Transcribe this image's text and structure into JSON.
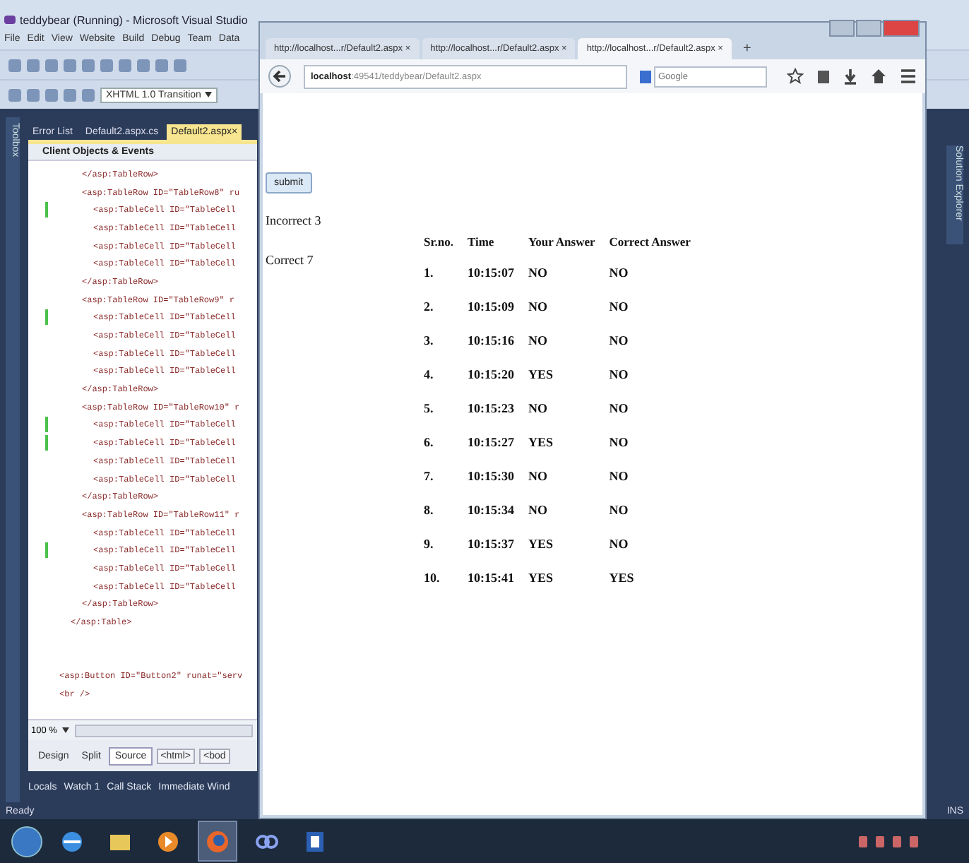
{
  "vs": {
    "title": "teddybear (Running) - Microsoft Visual Studio",
    "menu": [
      "File",
      "Edit",
      "View",
      "Website",
      "Build",
      "Debug",
      "Team",
      "Data"
    ],
    "toolbar_dropdown": "XHTML 1.0 Transition",
    "toolbox_label": "Toolbox",
    "doc_tabs": [
      {
        "label": "Error List",
        "selected": false
      },
      {
        "label": "Default2.aspx.cs",
        "selected": false
      },
      {
        "label": "Default2.aspx",
        "selected": true,
        "close": "×"
      }
    ],
    "member_dropdown": "Client Objects & Events",
    "code_lines": [
      {
        "text": "</asp:TableRow>",
        "kind": "row",
        "changed": false
      },
      {
        "text": "<asp:TableRow ID=\"TableRow8\" ru",
        "kind": "row",
        "changed": false
      },
      {
        "text": "<asp:TableCell ID=\"TableCell",
        "kind": "cell",
        "changed": true
      },
      {
        "text": "<asp:TableCell ID=\"TableCell",
        "kind": "cell",
        "changed": false
      },
      {
        "text": "<asp:TableCell ID=\"TableCell",
        "kind": "cell",
        "changed": false
      },
      {
        "text": "<asp:TableCell ID=\"TableCell",
        "kind": "cell",
        "changed": false
      },
      {
        "text": "</asp:TableRow>",
        "kind": "row",
        "changed": false
      },
      {
        "text": "<asp:TableRow ID=\"TableRow9\" r",
        "kind": "row",
        "changed": false
      },
      {
        "text": "<asp:TableCell ID=\"TableCell",
        "kind": "cell",
        "changed": true
      },
      {
        "text": "<asp:TableCell ID=\"TableCell",
        "kind": "cell",
        "changed": false
      },
      {
        "text": "<asp:TableCell ID=\"TableCell",
        "kind": "cell",
        "changed": false
      },
      {
        "text": "<asp:TableCell ID=\"TableCell",
        "kind": "cell",
        "changed": false
      },
      {
        "text": "</asp:TableRow>",
        "kind": "row",
        "changed": false
      },
      {
        "text": "<asp:TableRow ID=\"TableRow10\" r",
        "kind": "row",
        "changed": false
      },
      {
        "text": "<asp:TableCell ID=\"TableCell",
        "kind": "cell",
        "changed": true
      },
      {
        "text": "<asp:TableCell ID=\"TableCell",
        "kind": "cell",
        "changed": true
      },
      {
        "text": "<asp:TableCell ID=\"TableCell",
        "kind": "cell",
        "changed": false
      },
      {
        "text": "<asp:TableCell ID=\"TableCell",
        "kind": "cell",
        "changed": false
      },
      {
        "text": "</asp:TableRow>",
        "kind": "row",
        "changed": false
      },
      {
        "text": "<asp:TableRow ID=\"TableRow11\" r",
        "kind": "row",
        "changed": false
      },
      {
        "text": "<asp:TableCell ID=\"TableCell",
        "kind": "cell",
        "changed": false
      },
      {
        "text": "<asp:TableCell ID=\"TableCell",
        "kind": "cell",
        "changed": true
      },
      {
        "text": "<asp:TableCell ID=\"TableCell",
        "kind": "cell",
        "changed": false
      },
      {
        "text": "<asp:TableCell ID=\"TableCell",
        "kind": "cell",
        "changed": false
      },
      {
        "text": "</asp:TableRow>",
        "kind": "row",
        "changed": false
      },
      {
        "text": "</asp:Table>",
        "kind": "table",
        "changed": false
      }
    ],
    "code_lines_after": [
      {
        "text": "<asp:Button ID=\"Button2\" runat=\"serv",
        "kind": "form",
        "changed": false
      },
      {
        "text": "<br />",
        "kind": "form",
        "changed": false
      }
    ],
    "zoom": "100 %",
    "view_tabs": [
      {
        "label": "Design",
        "selected": false
      },
      {
        "label": "Split",
        "selected": false
      },
      {
        "label": "Source",
        "selected": true
      }
    ],
    "breadcrumbs": [
      "<html>",
      "<bod"
    ],
    "tool_tabs": [
      "Locals",
      "Watch 1",
      "Call Stack",
      "Immediate Wind"
    ],
    "status": "Ready",
    "ins": "INS",
    "solution_explorer_label": "Solution Explorer"
  },
  "browser": {
    "tabs": [
      {
        "label": "http://localhost...r/Default2.aspx",
        "selected": false,
        "close": "×"
      },
      {
        "label": "http://localhost...r/Default2.aspx",
        "selected": false,
        "close": "×"
      },
      {
        "label": "http://localhost...r/Default2.aspx",
        "selected": true,
        "close": "×"
      }
    ],
    "new_tab": "+",
    "url_host": "localhost",
    "url_path": ":49541/teddybear/Default2.aspx",
    "search_placeholder": "Google",
    "submit": "submit",
    "incorrect": "Incorrect 3",
    "correct": "Correct 7",
    "table": {
      "columns": [
        "Sr.no.",
        "Time",
        "Your Answer",
        "Correct Answer"
      ],
      "rows": [
        [
          "1.",
          "10:15:07",
          "NO",
          "NO"
        ],
        [
          "2.",
          "10:15:09",
          "NO",
          "NO"
        ],
        [
          "3.",
          "10:15:16",
          "NO",
          "NO"
        ],
        [
          "4.",
          "10:15:20",
          "YES",
          "NO"
        ],
        [
          "5.",
          "10:15:23",
          "NO",
          "NO"
        ],
        [
          "6.",
          "10:15:27",
          "YES",
          "NO"
        ],
        [
          "7.",
          "10:15:30",
          "NO",
          "NO"
        ],
        [
          "8.",
          "10:15:34",
          "NO",
          "NO"
        ],
        [
          "9.",
          "10:15:37",
          "YES",
          "NO"
        ],
        [
          "10.",
          "10:15:41",
          "YES",
          "YES"
        ]
      ]
    }
  },
  "taskbar": {
    "apps": [
      {
        "kind": "ie",
        "selected": false
      },
      {
        "kind": "folder",
        "selected": false
      },
      {
        "kind": "media",
        "selected": false
      },
      {
        "kind": "firefox",
        "selected": true
      },
      {
        "kind": "app",
        "selected": false
      },
      {
        "kind": "word",
        "selected": false
      }
    ]
  }
}
